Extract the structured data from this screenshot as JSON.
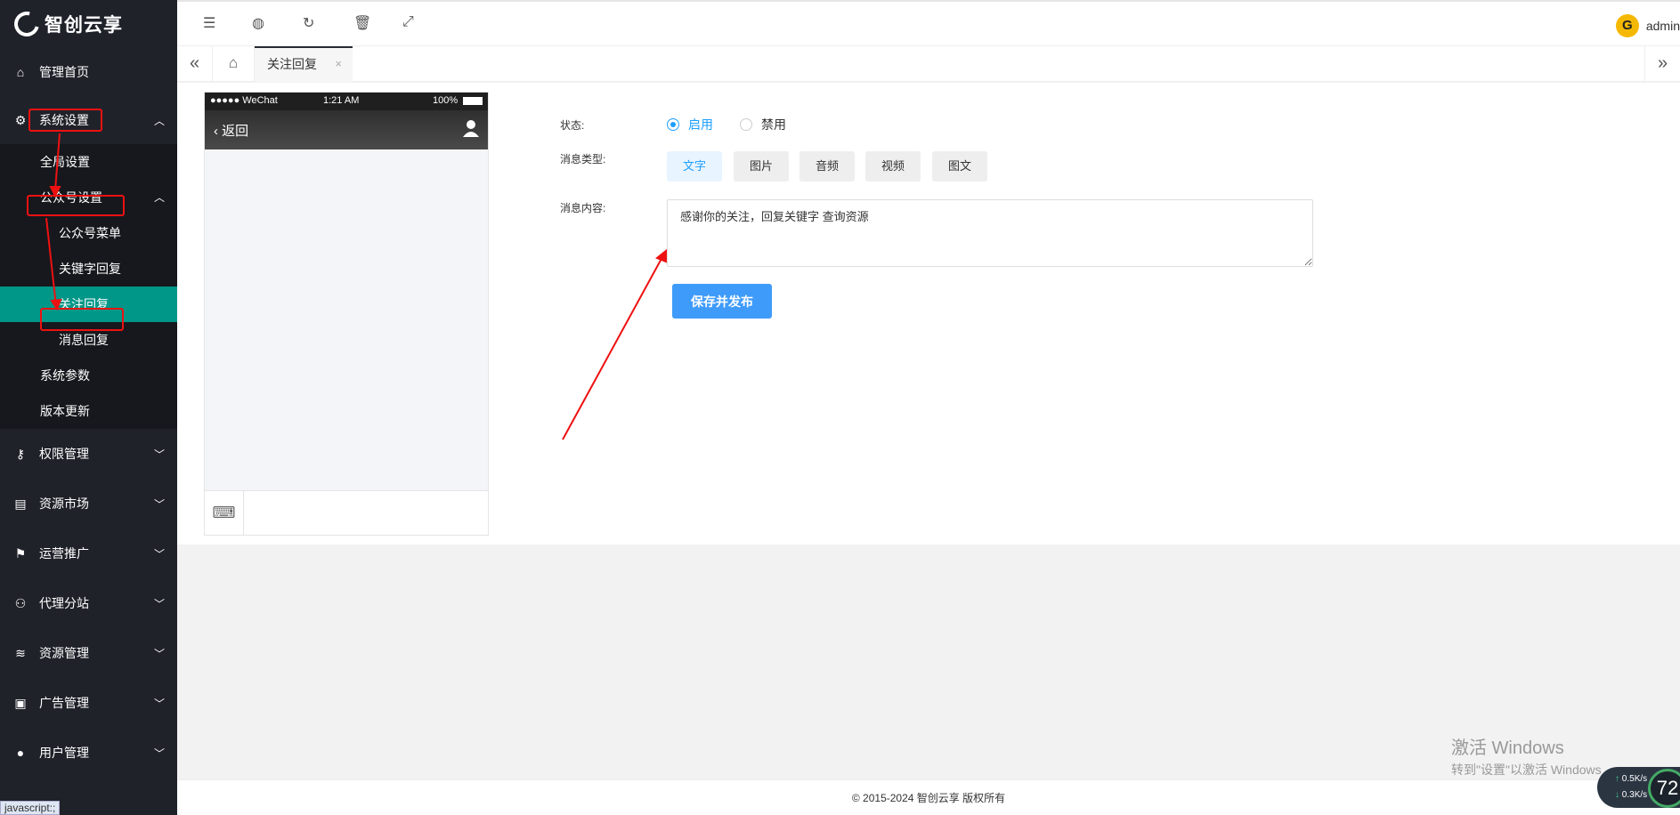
{
  "app": {
    "logo_text": "智创云享"
  },
  "sidebar": {
    "home": "管理首页",
    "system": "系统设置",
    "system_sub": {
      "global": "全局设置",
      "mp": "公众号设置",
      "mp_sub": [
        "公众号菜单",
        "关键字回复",
        "关注回复",
        "消息回复"
      ],
      "params": "系统参数",
      "update": "版本更新"
    },
    "groups": [
      "权限管理",
      "资源市场",
      "运营推广",
      "代理分站",
      "资源管理",
      "广告管理",
      "用户管理"
    ]
  },
  "topbar": {
    "user": "admin"
  },
  "tabs": {
    "active": "关注回复",
    "close": "×"
  },
  "phone": {
    "carrier": "●●●●● WeChat",
    "time": "1:21 AM",
    "battery": "100%",
    "back": "返回"
  },
  "form": {
    "status_label": "状态:",
    "status_on": "启用",
    "status_off": "禁用",
    "type_label": "消息类型:",
    "types": [
      "文字",
      "图片",
      "音频",
      "视频",
      "图文"
    ],
    "content_label": "消息内容:",
    "content_value": "感谢你的关注，回复关键字 查询资源",
    "save": "保存并发布"
  },
  "footer": {
    "copyright": "© 2015-2024 智创云享 版权所有"
  },
  "os": {
    "watermark_title": "激活 Windows",
    "watermark_sub": "转到\"设置\"以激活 Windows",
    "status_tip": "javascript:;",
    "net_up": "0.5",
    "net_up_unit": "K/s",
    "net_down": "0.3",
    "net_down_unit": "K/s",
    "gauge": "72"
  },
  "colors": {
    "sidebar_bg": "#20222a",
    "active": "#009688",
    "primary": "#1e9fff",
    "annotation": "#ee1111"
  }
}
